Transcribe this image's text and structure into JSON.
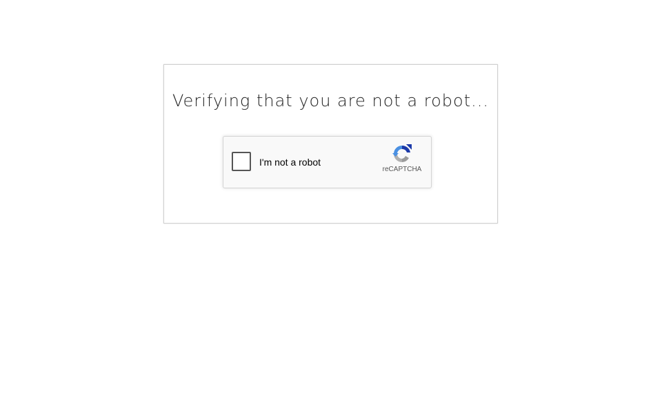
{
  "card": {
    "title": "Verifying that you are not a robot..."
  },
  "recaptcha": {
    "checkbox_label": "I'm not a robot",
    "brand": "reCAPTCHA",
    "checked": false,
    "logo_icon": "recaptcha-logo-icon",
    "colors": {
      "logo_blue_dark": "#1c3aa9",
      "logo_blue": "#4a90e2",
      "logo_gray": "#b0b0b0"
    }
  }
}
